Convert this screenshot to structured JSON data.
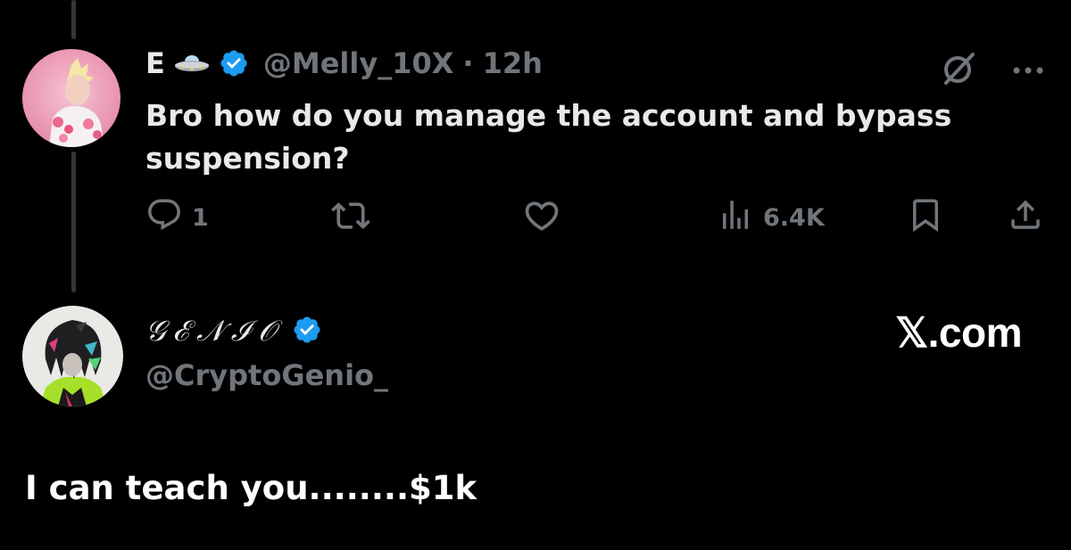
{
  "tweet": {
    "display_name": "E",
    "handle": "@Melly_10X",
    "separator": "·",
    "timestamp": "12h",
    "text": "Bro how do you manage the account and bypass suspension?",
    "reply_count": "1",
    "views": "6.4K"
  },
  "reply": {
    "display_name": "𝒢ℰ𝒩ℐ𝒪",
    "handle": "@CryptoGenio_",
    "watermark": "𝕏.com",
    "text": "I can teach you........$1k"
  },
  "icons": {
    "ufo": "ufo-icon",
    "verified": "verified-badge-icon",
    "grok": "slashed-circle-icon",
    "more": "more-icon",
    "reply": "reply-icon",
    "retweet": "retweet-icon",
    "like": "like-icon",
    "views": "views-icon",
    "bookmark": "bookmark-icon",
    "share": "share-icon"
  },
  "colors": {
    "background": "#000000",
    "primary_text": "#e7e9ea",
    "secondary_text": "#71767b",
    "verified_blue": "#1d9bf0",
    "thread_line": "#333639"
  }
}
